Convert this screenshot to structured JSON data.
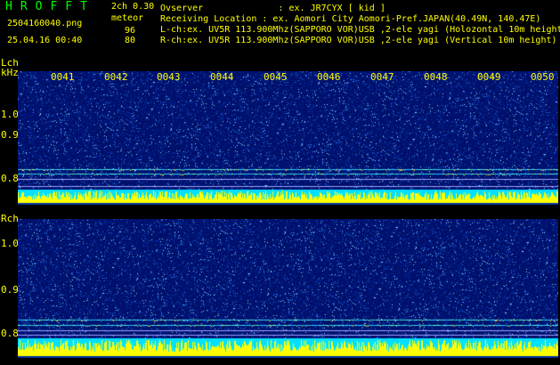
{
  "header": {
    "title": "HROFFT",
    "version": "2ch 0.30",
    "filename": "2504160040.png",
    "datetime": "25.04.16 00:40",
    "mode": "meteor",
    "count_l": "96",
    "count_r": "80",
    "observer_line": "Ovserver              : ex. JR7CYX [ kid ]",
    "location_line": "Receiving Location : ex. Aomori City Aomori-Pref.JAPAN(40.49N, 140.47E)",
    "lch_line": "L-ch:ex. UV5R 113.900Mhz(SAPPORO VOR)USB ,2-ele yagi (Holozontal 10m height",
    "rch_line": "R-ch:ex. UV5R 113.900Mhz(SAPPORO VOR)USB ,2-ele yagi (Vertical 10m height)"
  },
  "left_channel": {
    "label": "Lch",
    "unit": "kHz",
    "yticks": [
      "1.0",
      "0.9",
      "0.8"
    ],
    "time_labels": [
      "0041",
      "0042",
      "0043",
      "0044",
      "0045",
      "0046",
      "0047",
      "0048",
      "0049",
      "0050"
    ]
  },
  "right_channel": {
    "label": "Rch",
    "yticks": [
      "1.0",
      "0.9",
      "0.8"
    ]
  },
  "colors": {
    "background": "#000000",
    "text": "#ffff00",
    "title": "#00ff00",
    "waterfall_bg": "#00106a",
    "noise_floor": "#00e0ff",
    "signal_bar": "#ffff00"
  }
}
